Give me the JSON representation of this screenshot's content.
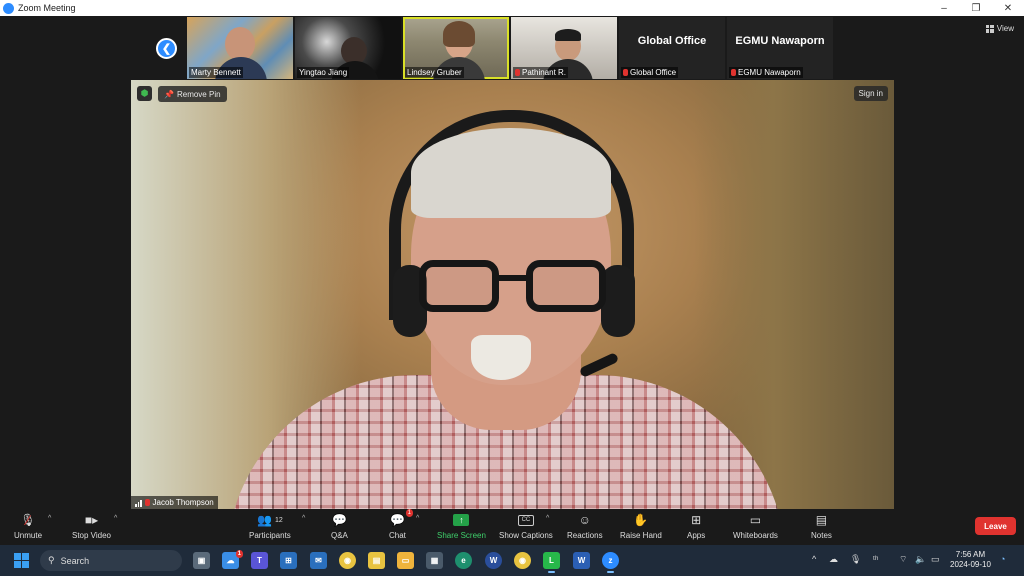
{
  "window": {
    "title": "Zoom Meeting",
    "buttons": {
      "minimize": "–",
      "restore": "❐",
      "close": "✕"
    }
  },
  "view_button": "View",
  "gallery": [
    {
      "name": "Marty Bennett",
      "muted": false
    },
    {
      "name": "Yingtao Jiang",
      "muted": false
    },
    {
      "name": "Lindsey Gruber",
      "muted": false
    },
    {
      "name": "Pathinant R.",
      "muted": true
    },
    {
      "name": "Global Office",
      "display_name": "Global Office",
      "muted": true
    },
    {
      "name": "EGMU Nawaporn",
      "display_name": "EGMU Nawaporn",
      "muted": true
    }
  ],
  "main_video": {
    "speaker": "Jacob Thompson",
    "remove_pin": "Remove Pin",
    "sign_in": "Sign in"
  },
  "toolbar": {
    "unmute": "Unmute",
    "stop_video": "Stop Video",
    "participants": "Participants",
    "participants_count": "12",
    "qa": "Q&A",
    "chat": "Chat",
    "chat_badge": "1",
    "share_screen": "Share Screen",
    "show_captions": "Show Captions",
    "reactions": "Reactions",
    "raise_hand": "Raise Hand",
    "apps": "Apps",
    "whiteboards": "Whiteboards",
    "notes": "Notes",
    "leave": "Leave"
  },
  "taskbar": {
    "search_placeholder": "Search",
    "weather_badge": "1",
    "time": "7:56 AM",
    "date": "2024-09-10"
  },
  "colors": {
    "accent": "#2d8cff",
    "leave": "#e0332f",
    "share": "#24a148",
    "active_speaker_outline": "#d9e028"
  }
}
